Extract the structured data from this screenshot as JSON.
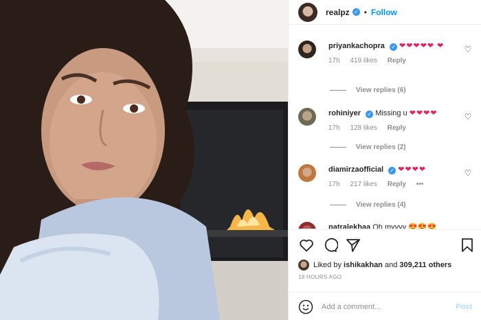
{
  "post": {
    "username": "realpz",
    "separator": "•",
    "follow_label": "Follow",
    "verified_glyph": "✓"
  },
  "comments": [
    {
      "username": "priyankachopra",
      "text": "",
      "hearts": "❤❤❤❤❤ ❤",
      "time": "17h",
      "likes": "419 likes",
      "reply_label": "Reply",
      "view_replies": "View replies (6)"
    },
    {
      "username": "rohiniyer",
      "text": "Missing u",
      "hearts": "❤❤❤❤",
      "time": "17h",
      "likes": "128 likes",
      "reply_label": "Reply",
      "view_replies": "View replies (2)"
    },
    {
      "username": "diamirzaofficial",
      "text": "",
      "hearts": "❤❤❤❤",
      "time": "17h",
      "likes": "217 likes",
      "reply_label": "Reply",
      "more": "•••",
      "view_replies": "View replies (4)"
    },
    {
      "username": "patralekhaa",
      "text": "Oh myyyy",
      "hearts": "😍😍😍"
    }
  ],
  "actions": {
    "icons": [
      "heart-icon",
      "comment-icon",
      "share-icon",
      "bookmark-icon"
    ]
  },
  "likes_summary": {
    "prefix": "Liked by",
    "user": "ishikakhan",
    "and": "and",
    "count": "309,211 others"
  },
  "timestamp": "18 HOURS AGO",
  "add_comment": {
    "placeholder": "Add a comment...",
    "post_label": "Post",
    "emoji_icon": "smiley-icon"
  },
  "colors": {
    "accent": "#0095f6",
    "verified": "#3897f0",
    "heart": "#e0245e",
    "muted": "#8e8e8e",
    "post_disabled": "#b2dffc"
  }
}
